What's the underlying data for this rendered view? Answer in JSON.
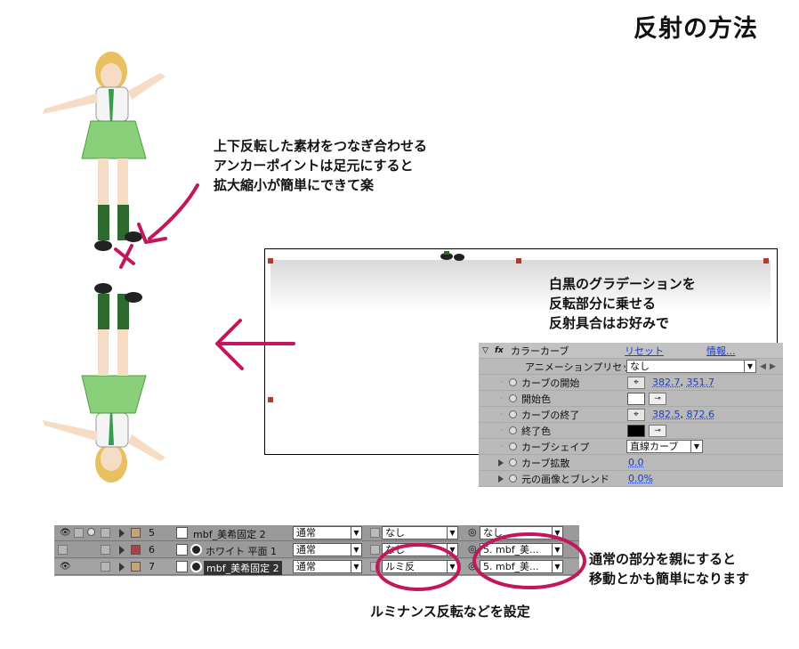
{
  "title": "反射の方法",
  "notes": {
    "anchor": [
      "上下反転した素材をつなぎ合わせる",
      "アンカーポイントは足元にすると",
      "拡大縮小が簡単にできて楽"
    ],
    "gradient": [
      "白黒のグラデーションを",
      "反転部分に乗せる",
      "反射具合はお好みで"
    ],
    "parent": [
      "通常の部分を親にすると",
      "移動とかも簡単になります"
    ],
    "luminance": "ルミナンス反転などを設定"
  },
  "effect_panel": {
    "fx_badge": "fx",
    "effect_name": "カラーカーブ",
    "reset": "リセット",
    "info": "情報...",
    "preset_label": "アニメーションプリセット：",
    "preset_value": "なし",
    "rows": [
      {
        "label": "カーブの開始",
        "x": "382.7",
        "y": "351.7"
      },
      {
        "label": "開始色"
      },
      {
        "label": "カーブの終了",
        "x": "382.5",
        "y": "872.6"
      },
      {
        "label": "終了色"
      },
      {
        "label": "カーブシェイプ",
        "value": "直線カーブ"
      },
      {
        "label": "カーブ拡散",
        "value": "0.0"
      },
      {
        "label": "元の画像とブレンド",
        "value": "0.0%"
      }
    ],
    "start_color": "#ffffff",
    "end_color": "#000000"
  },
  "layers": [
    {
      "num": "5",
      "name": "mbf_美希固定 2",
      "mode": "通常",
      "track": "なし",
      "parent": "なし",
      "color": "#c2a57a"
    },
    {
      "num": "6",
      "name": "ホワイト 平面 1",
      "mode": "通常",
      "track": "なし",
      "parent": "5. mbf_美...",
      "color": "#b34040"
    },
    {
      "num": "7",
      "name": "mbf_美希固定 2",
      "mode": "通常",
      "track": "ルミ反",
      "parent": "5. mbf_美...",
      "color": "#c2a57a"
    }
  ],
  "accent_color": "#c2185b"
}
